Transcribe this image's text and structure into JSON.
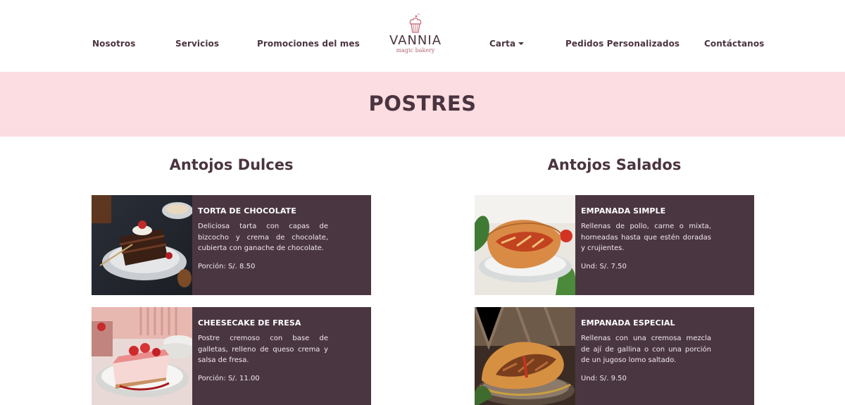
{
  "nav": {
    "items": [
      {
        "label": "Nosotros"
      },
      {
        "label": "Servicios"
      },
      {
        "label": "Promociones del mes"
      },
      {
        "label": "Carta"
      },
      {
        "label": "Pedidos Personalizados"
      },
      {
        "label": "Contáctanos"
      }
    ],
    "logo": {
      "name": "VANNIA",
      "sub": "magic bakery"
    }
  },
  "banner": {
    "title": "POSTRES"
  },
  "sections": {
    "dulces": {
      "heading": "Antojos Dulces",
      "cards": [
        {
          "title": "TORTA DE CHOCOLATE",
          "desc": "Deliciosa tarta con capas de bizcocho y crema de chocolate, cubierta con ganache de chocolate.",
          "price": "Porción: S/. 8.50"
        },
        {
          "title": "CHEESECAKE DE FRESA",
          "desc": "Postre cremoso con base de galletas, relleno de queso crema y salsa de fresa.",
          "price": "Porción: S/. 11.00"
        }
      ]
    },
    "salados": {
      "heading": "Antojos Salados",
      "cards": [
        {
          "title": "EMPANADA SIMPLE",
          "desc": "Rellenas de pollo, carne o mixta, horneadas hasta que estén doradas y crujientes.",
          "price": "Und: S/. 7.50"
        },
        {
          "title": "EMPANADA ESPECIAL",
          "desc": "Rellenas con una cremosa mezcla de ají de gallina o con una porción de un jugoso lomo saltado.",
          "price": "Und: S/. 9.50"
        }
      ]
    }
  },
  "colors": {
    "accent": "#4a3440",
    "card_bg": "#4a3641",
    "banner_bg": "#fcdde1"
  }
}
